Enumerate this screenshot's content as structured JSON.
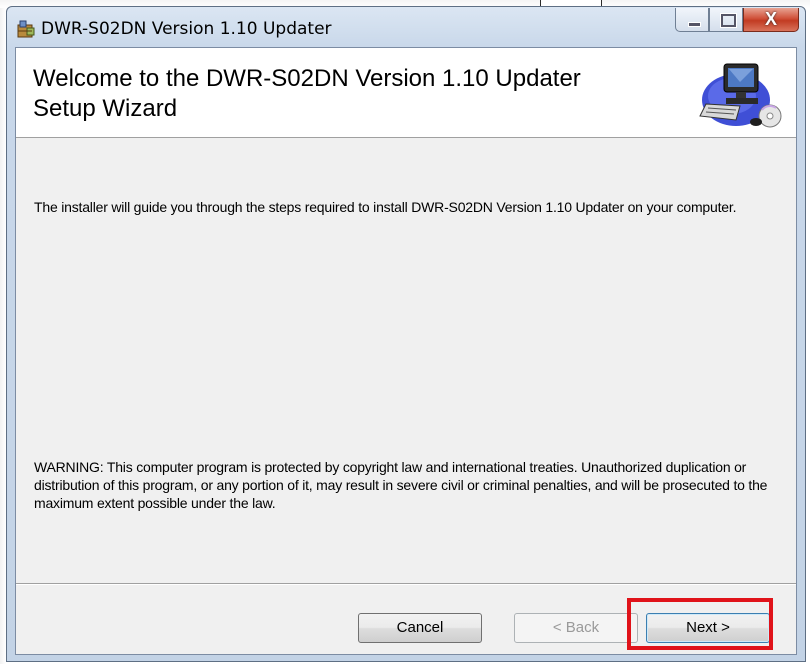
{
  "window": {
    "title": "DWR-S02DN Version 1.10 Updater",
    "close_glyph": "X"
  },
  "banner": {
    "title": "Welcome to the DWR-S02DN Version 1.10 Updater Setup Wizard",
    "art_icon": "computer-setup-icon"
  },
  "content": {
    "intro": "The installer will guide you through the steps required to install DWR-S02DN Version 1.10 Updater on your computer.",
    "warning": "WARNING: This computer program is protected by copyright law and international treaties. Unauthorized duplication or distribution of this program, or any portion of it, may result in severe civil or criminal penalties, and will be prosecuted to the maximum extent possible under the law."
  },
  "buttons": {
    "cancel": "Cancel",
    "back": "< Back",
    "next": "Next >"
  },
  "colors": {
    "highlight": "#e0131a",
    "banner_bg": "#ffffff",
    "dialog_bg": "#f0f0f0"
  }
}
